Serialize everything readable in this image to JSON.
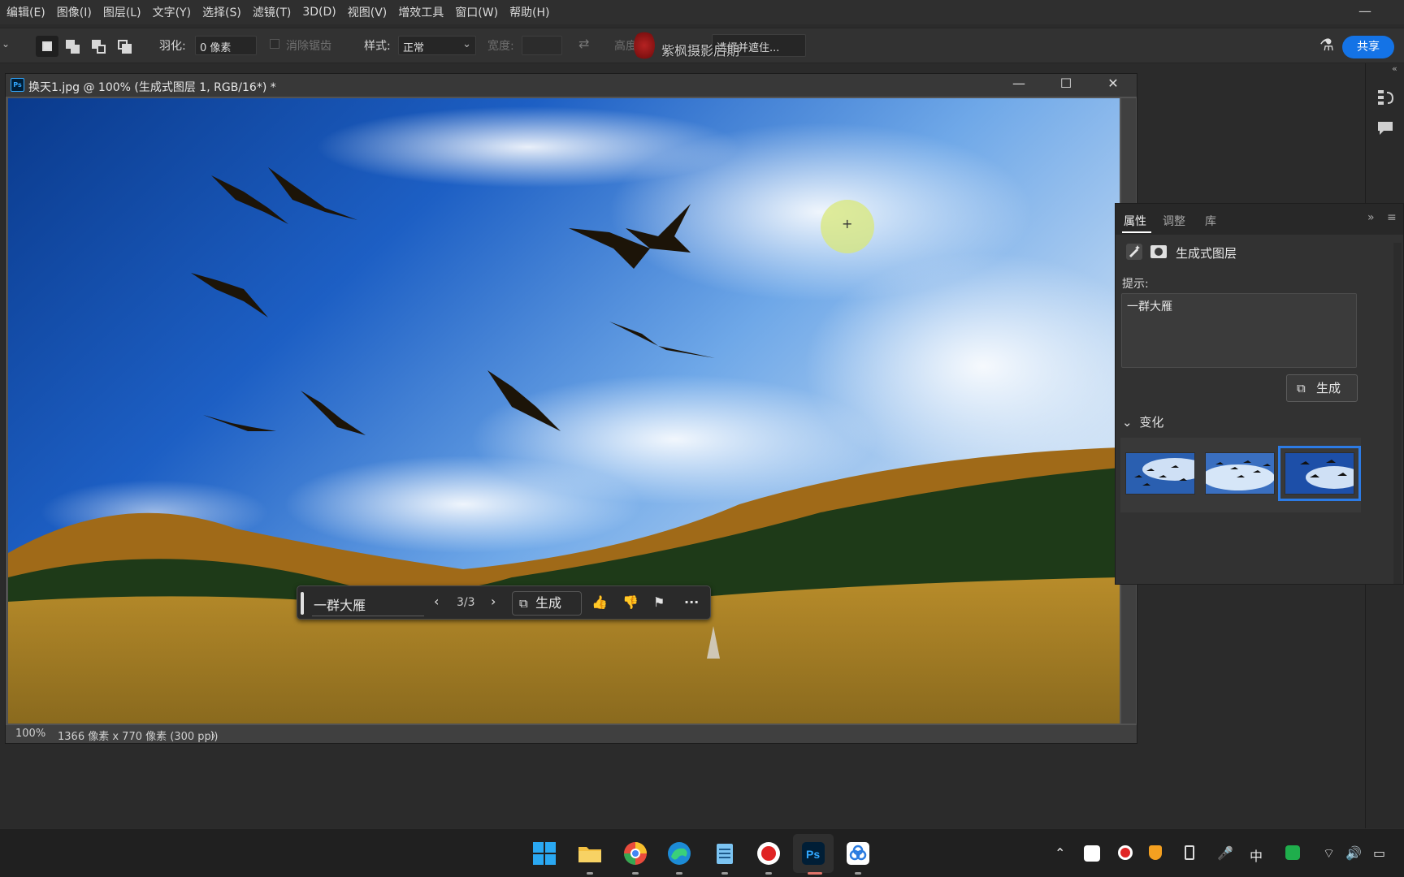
{
  "menu": [
    "编辑(E)",
    "图像(I)",
    "图层(L)",
    "文字(Y)",
    "选择(S)",
    "滤镜(T)",
    "3D(D)",
    "视图(V)",
    "增效工具",
    "窗口(W)",
    "帮助(H)"
  ],
  "options": {
    "feather_label": "羽化:",
    "feather_value": "0 像素",
    "antialias_label": "消除锯齿",
    "style_label": "样式:",
    "style_value": "正常",
    "width_label": "宽度:",
    "height_label": "高度:",
    "select_mask_label": "选择并遮住...",
    "watermark_text": "紫枫摄影后期",
    "share_label": "共享"
  },
  "document": {
    "title": "换天1.jpg @ 100% (生成式图层 1, RGB/16*) *",
    "zoom": "100%",
    "info": "1366 像素 x 770 像素 (300 ppi)",
    "info_arrow": "〉"
  },
  "contextual_taskbar": {
    "prompt": "一群大雁",
    "counter": "3/3",
    "generate_label": "生成",
    "more_label": "···"
  },
  "properties": {
    "tabs": [
      "属性",
      "调整",
      "库"
    ],
    "layer_type": "生成式图层",
    "prompt_label": "提示:",
    "prompt_value": "一群大雁",
    "generate_label": "生成",
    "variations_label": "变化",
    "variations_count": 3,
    "selected_variation": 3,
    "panel_collapse": "»",
    "panel_menu": "≡"
  },
  "tray": {
    "ime": "中"
  },
  "colors": {
    "accent": "#1473e6",
    "selection_outline": "#2c7be5",
    "brush_cursor": "#d9e87a"
  }
}
